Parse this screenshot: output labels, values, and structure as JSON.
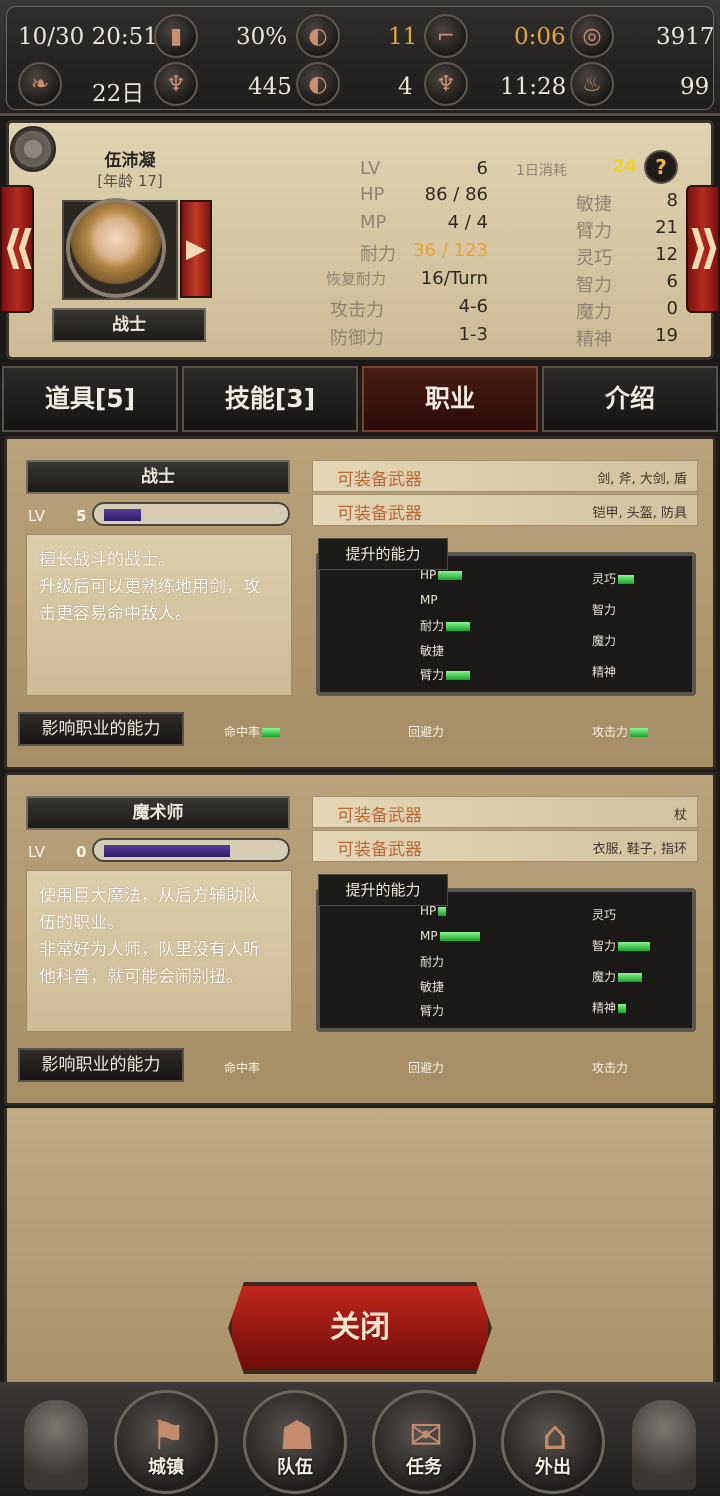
{
  "topbar": {
    "datetime": "10/30 20:51",
    "battery": "30%",
    "meat": "11",
    "boot_timer": "0:06",
    "coins": "3917",
    "days": "22日",
    "fairy": "445",
    "meat2": "4",
    "time2": "11:28",
    "pot": "99",
    "icons": [
      "battery-icon",
      "meat-icon",
      "boot-icon",
      "coins-icon",
      "leaf-icon",
      "fairy-icon",
      "meat-icon",
      "fairy-icon",
      "pot-icon"
    ]
  },
  "character": {
    "name": "伍沛凝",
    "age": "[年龄 17]",
    "class": "战士",
    "stats_left": [
      {
        "label": "LV",
        "value": "6"
      },
      {
        "label": "HP",
        "value": "86 / 86"
      },
      {
        "label": "MP",
        "value": "4 / 4"
      },
      {
        "label": "耐力",
        "value": "36 / 123"
      },
      {
        "label": "恢复耐力",
        "value": "16/Turn"
      },
      {
        "label": "攻击力",
        "value": "4-6"
      },
      {
        "label": "防御力",
        "value": "1-3"
      }
    ],
    "daily_cost_label": "1日消耗",
    "daily_cost_value": "24",
    "help": "?",
    "stats_right": [
      {
        "label": "敏捷",
        "value": "8"
      },
      {
        "label": "臂力",
        "value": "21"
      },
      {
        "label": "灵巧",
        "value": "12"
      },
      {
        "label": "智力",
        "value": "6"
      },
      {
        "label": "魔力",
        "value": "0"
      },
      {
        "label": "精神",
        "value": "19"
      }
    ]
  },
  "tabs": [
    "道具[5]",
    "技能[3]",
    "职业",
    "介绍"
  ],
  "classes": [
    {
      "name": "战士",
      "lv_label": "LV",
      "lv": "5",
      "xp_fraction": 0.22,
      "equip": [
        {
          "label": "可装备武器",
          "items": "剑, 斧, 大剑, 盾"
        },
        {
          "label": "可装备武器",
          "items": "铠甲, 头盔, 防具"
        }
      ],
      "description": [
        "擅长战斗的战士。",
        "升级后可以更熟练地用剑，攻",
        "击更容易命中敌人。"
      ],
      "boost_title": "提升的能力",
      "boost_left": [
        {
          "label": "HP",
          "bar": 3
        },
        {
          "label": "MP",
          "bar": 0
        },
        {
          "label": "耐力",
          "bar": 3
        },
        {
          "label": "敏捷",
          "bar": 0
        },
        {
          "label": "臂力",
          "bar": 3
        }
      ],
      "boost_right": [
        {
          "label": "灵巧",
          "bar": 2
        },
        {
          "label": "智力",
          "bar": 0
        },
        {
          "label": "魔力",
          "bar": 0
        },
        {
          "label": "精神",
          "bar": 0
        }
      ],
      "affect_title": "影响职业的能力",
      "affect": [
        {
          "label": "命中率",
          "bar": 2
        },
        {
          "label": "回避力",
          "bar": 0
        },
        {
          "label": "攻击力",
          "bar": 2
        }
      ]
    },
    {
      "name": "魔术师",
      "lv_label": "LV",
      "lv": "0",
      "xp_fraction": 0.74,
      "equip": [
        {
          "label": "可装备武器",
          "items": "杖"
        },
        {
          "label": "可装备武器",
          "items": "衣服, 鞋子, 指环"
        }
      ],
      "description": [
        "使用巨大魔法，从后方辅助队",
        "伍的职业。",
        "非常好为人师，队里没有人听",
        "他科普，就可能会闹别扭。"
      ],
      "boost_title": "提升的能力",
      "boost_left": [
        {
          "label": "HP",
          "bar": 1
        },
        {
          "label": "MP",
          "bar": 5
        },
        {
          "label": "耐力",
          "bar": 0
        },
        {
          "label": "敏捷",
          "bar": 0
        },
        {
          "label": "臂力",
          "bar": 0
        }
      ],
      "boost_right": [
        {
          "label": "灵巧",
          "bar": 0
        },
        {
          "label": "智力",
          "bar": 4
        },
        {
          "label": "魔力",
          "bar": 3
        },
        {
          "label": "精神",
          "bar": 1
        }
      ],
      "affect_title": "影响职业的能力",
      "affect": [
        {
          "label": "命中率",
          "bar": 0
        },
        {
          "label": "回避力",
          "bar": 0
        },
        {
          "label": "攻击力",
          "bar": 0
        }
      ]
    }
  ],
  "close_label": "关闭",
  "bottom_nav": [
    {
      "label": "城镇",
      "icon": "flag-icon"
    },
    {
      "label": "队伍",
      "icon": "party-icon"
    },
    {
      "label": "任务",
      "icon": "envelope-icon"
    },
    {
      "label": "外出",
      "icon": "door-icon"
    }
  ],
  "colors": {
    "accent_red": "#b42a20",
    "boost_green": "#2fc03f",
    "stamina_orange": "#e8a23a",
    "xp_purple": "#3f2a80"
  }
}
